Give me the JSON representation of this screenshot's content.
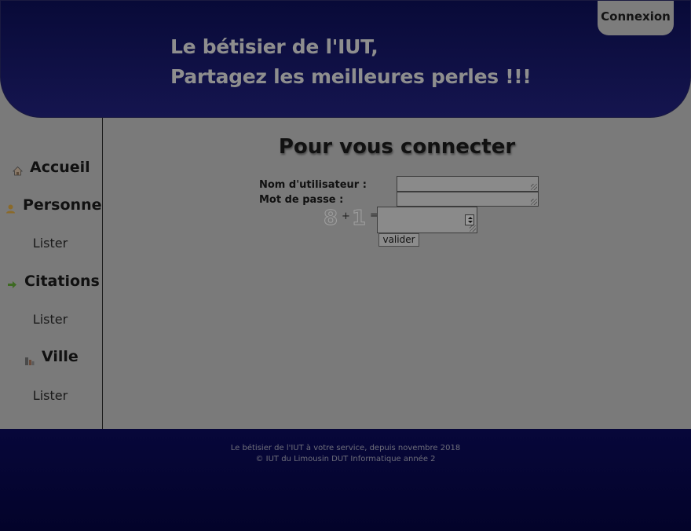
{
  "header": {
    "title_line1": "Le bétisier de l'IUT,",
    "title_line2": "Partagez les meilleures perles !!!",
    "login_tab": "Connexion"
  },
  "sidebar": {
    "sections": [
      {
        "label": "Accueil",
        "icon": "home-icon"
      },
      {
        "label": "Personne",
        "icon": "person-icon",
        "sub": "Lister"
      },
      {
        "label": "Citations",
        "icon": "arrow-right-icon",
        "sub": "Lister"
      },
      {
        "label": "Ville",
        "icon": "city-icon",
        "sub": "Lister"
      }
    ]
  },
  "main": {
    "title": "Pour vous connecter",
    "username_label": "Nom d'utilisateur :",
    "password_label": "Mot de passe :",
    "captcha": {
      "a": "8",
      "op": "+",
      "b": "1",
      "eq": "="
    },
    "submit_label": "valider"
  },
  "footer": {
    "line1": "Le bétisier de l'IUT à votre service, depuis novembre 2018",
    "line2": "© IUT du Limousin DUT Informatique année 2"
  },
  "colors": {
    "header_bg": "#0c0c44",
    "overlay": "#7a7a7a",
    "footer_bg": "#05053a"
  }
}
